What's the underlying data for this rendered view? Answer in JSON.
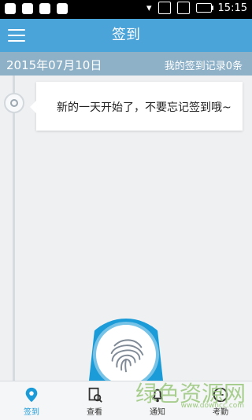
{
  "status": {
    "time": "15:15"
  },
  "header": {
    "title": "签到"
  },
  "datebar": {
    "date": "2015年07月10日",
    "records": "我的签到记录0条"
  },
  "card": {
    "text": "新的一天开始了，不要忘记签到哦~"
  },
  "tabs": [
    {
      "label": "签到",
      "icon": "location-pin-icon"
    },
    {
      "label": "查看",
      "icon": "document-search-icon"
    },
    {
      "label": "通知",
      "icon": "bell-icon"
    },
    {
      "label": "考勤",
      "icon": "clock-icon"
    }
  ],
  "watermark": {
    "main": "绿色资源网",
    "sub": "www.downcc.com"
  },
  "colors": {
    "accent": "#1b9bd8",
    "header": "#4aa3d9",
    "datebar": "#8fb1c8"
  }
}
